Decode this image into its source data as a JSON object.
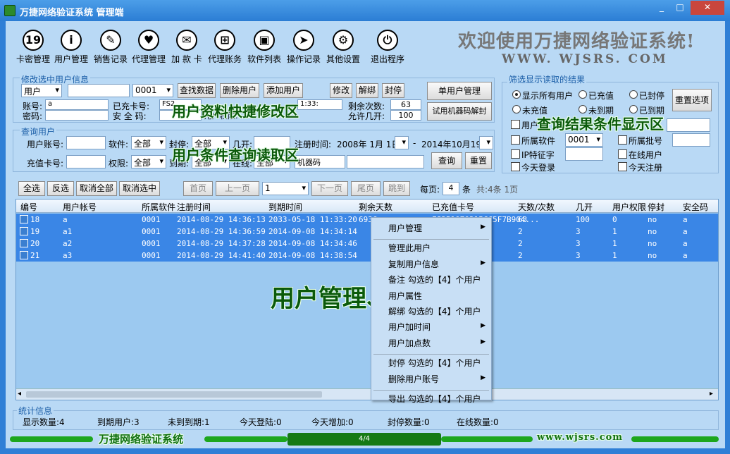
{
  "window": {
    "title": "万捷网络验证系统 管理端",
    "min": "_",
    "max": "□",
    "close": "✕"
  },
  "toolbar": [
    {
      "name": "card-code-manage",
      "label": "卡密管理",
      "glyph": "19"
    },
    {
      "name": "user-manage",
      "label": "用户管理",
      "glyph": "i"
    },
    {
      "name": "sales-record",
      "label": "销售记录",
      "glyph": "✎"
    },
    {
      "name": "agent-manage",
      "label": "代理管理",
      "glyph": "♥"
    },
    {
      "name": "add-card",
      "label": "加 款 卡",
      "glyph": "✉"
    },
    {
      "name": "agent-account",
      "label": "代理账务",
      "glyph": "⊞"
    },
    {
      "name": "software-list",
      "label": "软件列表",
      "glyph": "▣"
    },
    {
      "name": "operation-log",
      "label": "操作记录",
      "glyph": "➤"
    },
    {
      "name": "other-settings",
      "label": "其他设置",
      "glyph": "⚙"
    },
    {
      "name": "exit-program",
      "label": "退出程序",
      "glyph": "⏻"
    }
  ],
  "welcome": "欢迎使用万捷网络验证系统!",
  "website": "WWW. WJSRS. COM",
  "modify": {
    "title": "修改选中用户信息",
    "field_select": "用户",
    "code_select": "0001",
    "btn_find": "查找数据",
    "btn_delete": "删除用户",
    "btn_add": "添加用户",
    "btn_modify": "修改",
    "btn_unbind": "解绑",
    "btn_ban": "封停",
    "btn_single": "单用户管理",
    "btn_trial": "试用机器码解封",
    "lbl_account": "账号:",
    "account_val": "a",
    "lbl_password": "密码:",
    "lbl_card": "已充卡号:",
    "card_val": "FS2",
    "lbl_safe": "安 全 码:",
    "lbl_perm": "用户权限:",
    "time_val": "1:33:",
    "lbl_remain": "剩余次数:",
    "remain_val": "63",
    "lbl_allow": "允许几开:",
    "allow_val": "100"
  },
  "query": {
    "title": "查询用户",
    "lbl_account": "用户账号:",
    "lbl_software": "软件:",
    "software_val": "全部",
    "lbl_ban": "封停:",
    "ban_val": "全部",
    "lbl_open": "几开:",
    "lbl_regtime": "注册时间:",
    "date_from": "2008年 1月 1日",
    "date_sep": "-",
    "date_to": "2014年10月19日",
    "lbl_recharge": "充值卡号:",
    "lbl_perm": "权限:",
    "perm_val": "全部",
    "lbl_expire": "到期:",
    "expire_val": "全部",
    "lbl_online": "在线:",
    "online_val": "全部",
    "lbl_machine": "机器码",
    "btn_query": "查询",
    "btn_reset": "重置"
  },
  "filter": {
    "title": "筛选显示读取的结果",
    "r1": "显示所有用户",
    "r2": "已充值",
    "r3": "已封停",
    "r4": "未充值",
    "r5": "未到期",
    "r6": "已到期",
    "btn_reset": "重置选项",
    "c_user": "用户",
    "c_soft": "所属软件",
    "soft_val": "0001",
    "c_batch": "所属批号",
    "c_ip": "IP特征字",
    "c_online": "在线用户",
    "c_login": "今天登录",
    "c_reg": "今天注册"
  },
  "annotations": {
    "modify": "用户资料快捷修改区",
    "query": "用户条件查询读取区",
    "result": "查询结果条件显示区",
    "grid": "用户管理、显示区"
  },
  "pager": {
    "sel_all": "全选",
    "invert": "反选",
    "cancel_all": "取消全部",
    "cancel_sel": "取消选中",
    "first": "首页",
    "prev": "上一页",
    "page_val": "1",
    "next": "下一页",
    "last": "尾页",
    "jump": "跳到",
    "lbl_per": "每页:",
    "per_val": "4",
    "lbl_unit": "条",
    "summary": "共:4条 1页"
  },
  "grid": {
    "columns": [
      "编号",
      "用户帐号",
      "所属软件",
      "注册时间",
      "到期时间",
      "剩余天数",
      "已充值卡号",
      "天数/次数",
      "几开",
      "用户权限",
      "停封",
      "安全码"
    ],
    "rows": [
      [
        "18",
        "a",
        "0001",
        "2014-08-29 14:36:13",
        "2033-05-18 11:33:20",
        "6936",
        "FS3P1Q7Q21PCC5F7B904...",
        "63",
        "100",
        "0",
        "no",
        "a"
      ],
      [
        "19",
        "a1",
        "0001",
        "2014-08-29 14:36:59",
        "2014-09-08 14:34:14",
        "",
        "",
        "2",
        "3",
        "1",
        "no",
        "a"
      ],
      [
        "20",
        "a2",
        "0001",
        "2014-08-29 14:37:28",
        "2014-09-08 14:34:46",
        "",
        "",
        "2",
        "3",
        "1",
        "no",
        "a"
      ],
      [
        "21",
        "a3",
        "0001",
        "2014-08-29 14:41:40",
        "2014-09-08 14:38:54",
        "",
        "",
        "2",
        "3",
        "1",
        "no",
        "a"
      ]
    ]
  },
  "context_menu": [
    {
      "label": "用户管理",
      "sub": true
    },
    {
      "sep": true
    },
    {
      "label": "管理此用户",
      "sub": false
    },
    {
      "label": "复制用户信息",
      "sub": true
    },
    {
      "label": "备注 勾选的【4】个用户",
      "sub": false
    },
    {
      "label": "用户属性",
      "sub": false
    },
    {
      "label": "解绑 勾选的【4】个用户",
      "sub": false
    },
    {
      "label": "用户加时间",
      "sub": true
    },
    {
      "label": "用户加点数",
      "sub": true
    },
    {
      "sep": true
    },
    {
      "label": "封停 勾选的【4】个用户",
      "sub": false
    },
    {
      "label": "删除用户账号",
      "sub": true
    },
    {
      "sep": true
    },
    {
      "label": "导出 勾选的【4】个用户",
      "sub": false
    }
  ],
  "stats": {
    "title": "统计信息",
    "items": [
      "显示数量:4",
      "到期用户:3",
      "未到到期:1",
      "今天登陆:0",
      "今天增加:0",
      "封停数量:0",
      "在线数量:0"
    ]
  },
  "statusbar": {
    "name": "万捷网络验证系统",
    "page": "4/4",
    "url": "www.wjsrs.com"
  }
}
